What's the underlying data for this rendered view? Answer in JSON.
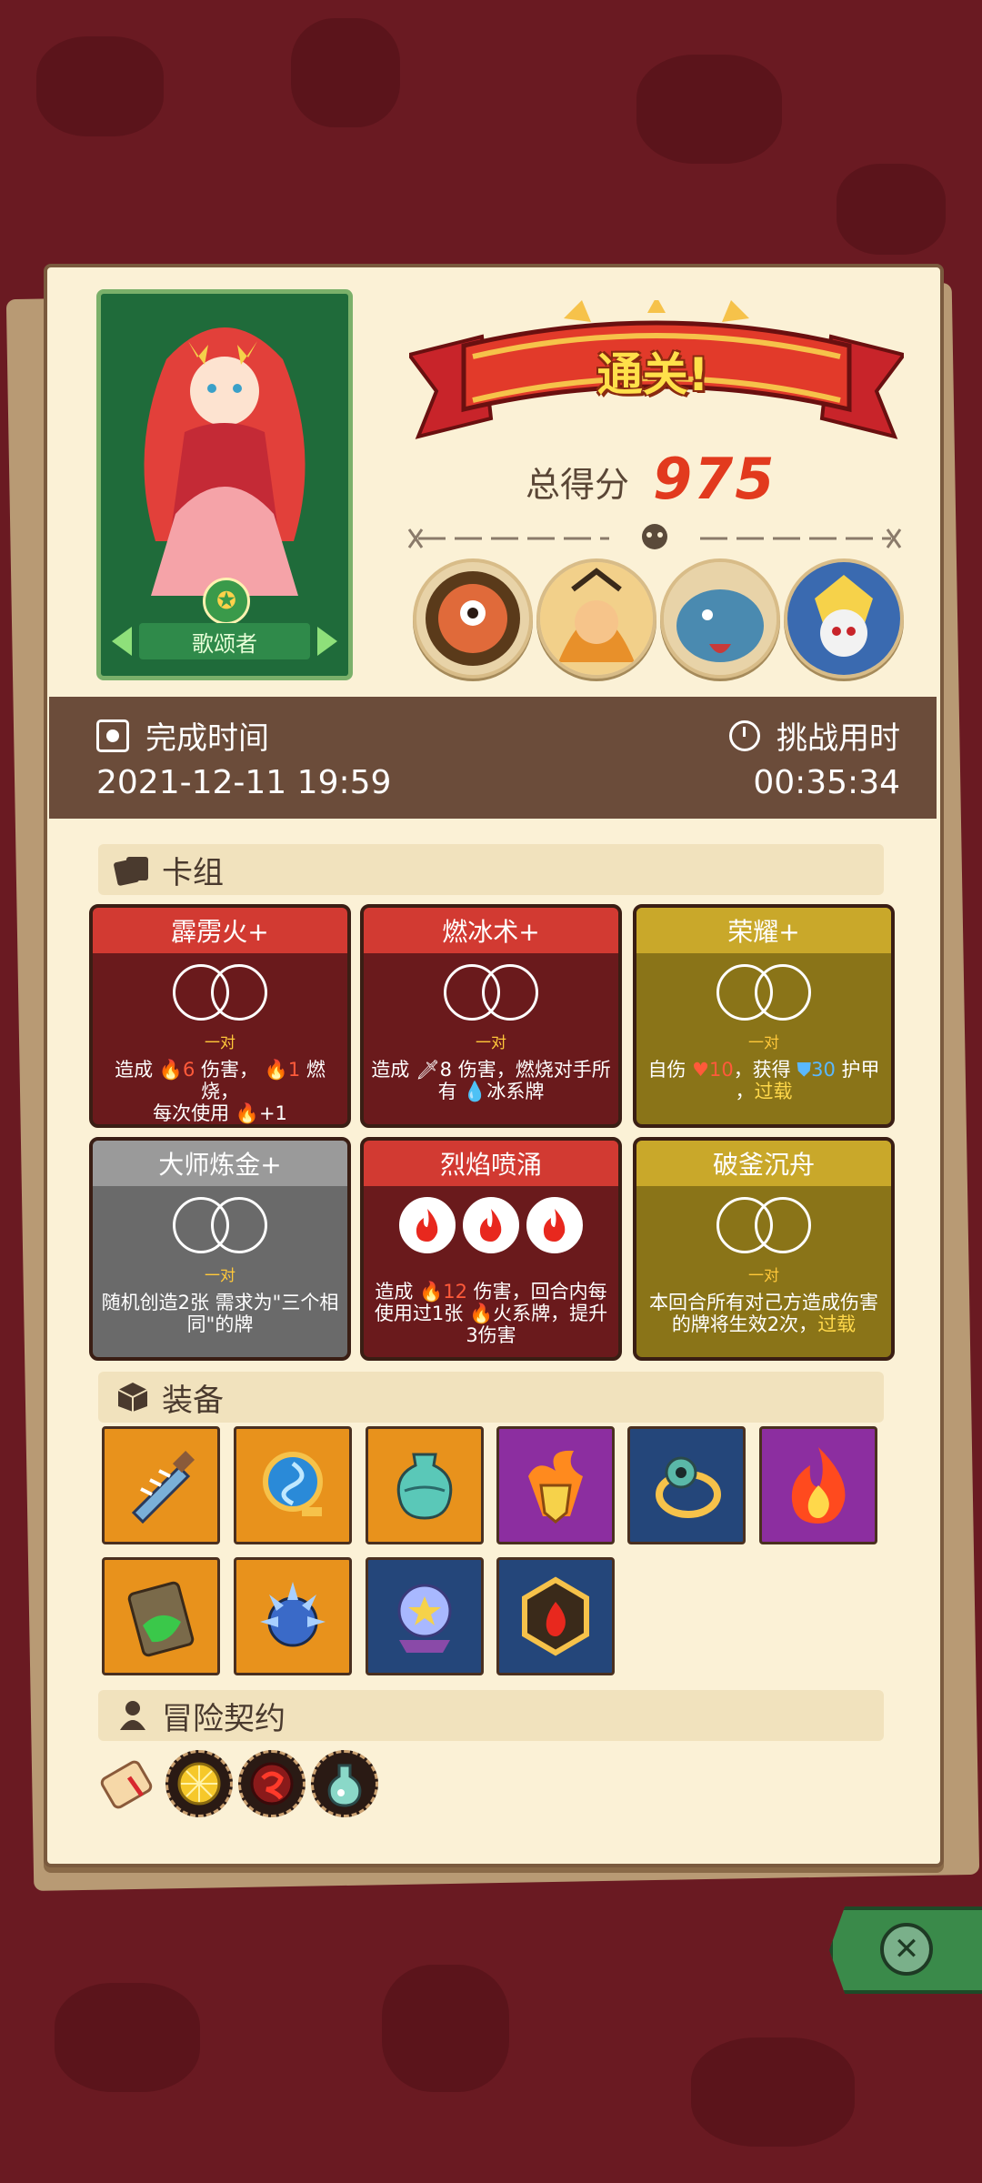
{
  "result": {
    "banner": "通关!",
    "score_label": "总得分",
    "score": "975"
  },
  "hero": {
    "name": "歌颂者"
  },
  "time": {
    "finish_label": "完成时间",
    "finish_value": "2021-12-11 19:59",
    "challenge_label": "挑战用时",
    "challenge_value": "00:35:34"
  },
  "sections": {
    "deck": "卡组",
    "equipment": "装备",
    "contract": "冒险契约"
  },
  "cards": [
    {
      "name": "霹雳火+",
      "color": "red",
      "sub": "一对",
      "desc_a": "造成 ",
      "val1": "6",
      "desc_b": " 伤害， ",
      "val2": "1",
      "desc_c": " 燃烧，",
      "desc_d": "每次使用 ",
      "val3": "+1"
    },
    {
      "name": "燃冰术+",
      "color": "red",
      "sub": "一对",
      "desc_line1": "造成 ",
      "val1": "8",
      "desc_line1b": " 伤害，燃烧对手所",
      "desc_line2": "有 ",
      "desc_line2b": "冰系牌"
    },
    {
      "name": "荣耀+",
      "color": "gold",
      "sub": "一对",
      "desc_a": "自伤 ",
      "val1": "10",
      "desc_b": "，获得 ",
      "val2": "30",
      "desc_c": " 护甲",
      "desc_d": "，",
      "keyword": "过载"
    },
    {
      "name": "大师炼金+",
      "color": "gray",
      "sub": "一对",
      "desc": "随机创造2张 需求为\"三个相同\"的牌"
    },
    {
      "name": "烈焰喷涌",
      "color": "red",
      "desc_a": "造成 ",
      "val1": "12",
      "desc_b": " 伤害，回合内每使用过1张 ",
      "desc_c": "火系牌，提升3伤害"
    },
    {
      "name": "破釜沉舟",
      "color": "gold",
      "sub": "一对",
      "desc": "本回合所有对己方造成伤害的牌将生效2次，",
      "keyword": "过载"
    }
  ],
  "equipment": [
    {
      "icon": "spiked-bottle-icon",
      "color": "#e8921c"
    },
    {
      "icon": "blue-vortex-orb-icon",
      "color": "#e8921c"
    },
    {
      "icon": "teal-vase-icon",
      "color": "#e8921c"
    },
    {
      "icon": "flaming-shield-icon",
      "color": "#8c2ea0"
    },
    {
      "icon": "eye-ring-icon",
      "color": "#24467a"
    },
    {
      "icon": "fire-icon",
      "color": "#8c2ea0"
    },
    {
      "icon": "green-slime-tablet-icon",
      "color": "#e8921c"
    },
    {
      "icon": "spiked-blue-orb-icon",
      "color": "#e8921c"
    },
    {
      "icon": "star-crystal-ball-icon",
      "color": "#24467a"
    },
    {
      "icon": "fire-hex-amulet-icon",
      "color": "#24467a"
    }
  ],
  "contracts": [
    {
      "icon": "scroll-icon"
    },
    {
      "icon": "lemon-icon"
    },
    {
      "icon": "red-rune-icon"
    },
    {
      "icon": "potion-icon"
    }
  ],
  "colors": {
    "panel": "#fbf1d6",
    "timebar": "#6b4c3a",
    "score": "#e23a1e",
    "card_red": "#d23a32",
    "card_gold": "#c9a82a",
    "card_gray": "#9a9a9a"
  }
}
